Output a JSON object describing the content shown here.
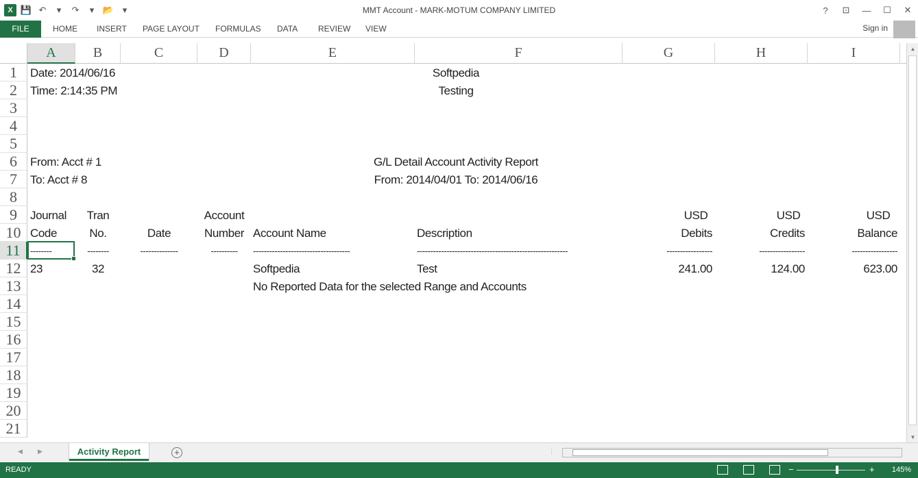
{
  "window": {
    "title": "MMT Account - MARK-MOTUM COMPANY LIMITED",
    "help": "?",
    "minimize": "—",
    "maximize": "☐",
    "close": "✕"
  },
  "qat": {
    "save_icon": "💾",
    "undo_icon": "↶",
    "redo_icon": "↷",
    "open_icon": "📂",
    "more_icon": "▾"
  },
  "ribbon": {
    "tabs": [
      "FILE",
      "HOME",
      "INSERT",
      "PAGE LAYOUT",
      "FORMULAS",
      "DATA",
      "REVIEW",
      "VIEW"
    ],
    "signin": "Sign in"
  },
  "columns": [
    "A",
    "B",
    "C",
    "D",
    "E",
    "F",
    "G",
    "H",
    "I"
  ],
  "rows": [
    "1",
    "2",
    "3",
    "4",
    "5",
    "6",
    "7",
    "8",
    "9",
    "10",
    "11",
    "12",
    "13",
    "14",
    "15",
    "16",
    "17",
    "18",
    "19",
    "20",
    "21"
  ],
  "cells": {
    "A1": "Date: 2014/06/16",
    "F1": "Softpedia",
    "A2": "Time: 2:14:35 PM",
    "F2": "Testing",
    "A6": "From: Acct # 1",
    "F6": "G/L Detail Account Activity Report",
    "A7": "To: Acct # 8",
    "F7": "From:  2014/04/01  To:  2014/06/16",
    "A9": "Journal",
    "B9": "Tran",
    "D9": "Account",
    "G9": "USD",
    "H9": "USD",
    "I9": "USD",
    "A10": "Code",
    "B10": "No.",
    "C10": "Date",
    "D10": "Number",
    "E10": "Account Name",
    "F10": "Description",
    "G10": "Debits",
    "H10": "Credits",
    "I10": "Balance",
    "A11": "--------",
    "B11": "--------",
    "C11": "--------------",
    "D11": "----------",
    "E11": "------------------------------------",
    "F11": "--------------------------------------------------------",
    "G11": "-----------------",
    "H11": "-----------------",
    "I11": "-----------------",
    "A12": "23",
    "B12": "32",
    "E12": "Softpedia",
    "F12": "Test",
    "G12": "241.00",
    "H12": "124.00",
    "I12": "623.00",
    "E13": "No Reported Data for the selected Range and Accounts"
  },
  "selected_cell": "A11",
  "sheets": {
    "active": "Activity Report",
    "add": "+"
  },
  "status": {
    "ready": "READY",
    "zoom": "145%",
    "minus": "−",
    "plus": "+"
  },
  "colors": {
    "accent": "#217346"
  }
}
